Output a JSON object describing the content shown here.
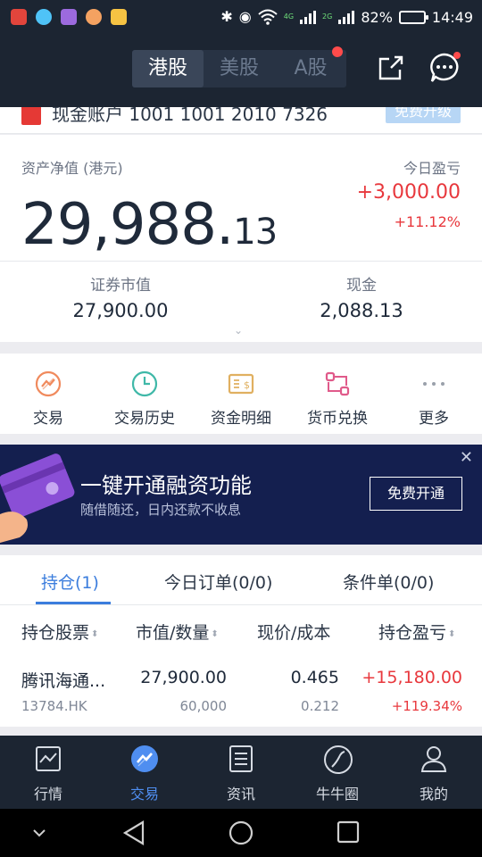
{
  "status_bar": {
    "network_labels": [
      "4G",
      "2G"
    ],
    "battery_percent": "82%",
    "battery_level": 0.82,
    "time": "14:49",
    "app_icons": [
      "weibo-icon",
      "heart-app-icon",
      "photo-app-icon",
      "game-app-icon",
      "wallet-app-icon"
    ],
    "system_icons": [
      "bluetooth-icon",
      "eye-icon",
      "wifi-icon"
    ]
  },
  "header": {
    "market_tabs": [
      {
        "label": "港股",
        "active": true
      },
      {
        "label": "美股",
        "active": false
      },
      {
        "label": "A股",
        "active": false,
        "badge": true
      }
    ],
    "icons": [
      "share-icon",
      "message-icon"
    ]
  },
  "account": {
    "text": "现金账户  1001 1001 2010 7326",
    "upgrade_button": "免费升级"
  },
  "assets": {
    "net_value_label": "资产净值 (港元)",
    "net_value_int": "29,988.",
    "net_value_dec": "13",
    "today_pl_label": "今日盈亏",
    "today_pl_value": "+3,000.00",
    "today_pl_pct": "+11.12%",
    "market_value_label": "证券市值",
    "market_value": "27,900.00",
    "cash_label": "现金",
    "cash_value": "2,088.13"
  },
  "actions": [
    {
      "label": "交易",
      "icon": "trade-icon",
      "color": "#f08a5d"
    },
    {
      "label": "交易历史",
      "icon": "clock-icon",
      "color": "#3fb8a8"
    },
    {
      "label": "资金明细",
      "icon": "fund-detail-icon",
      "color": "#e0b060"
    },
    {
      "label": "货币兑换",
      "icon": "exchange-icon",
      "color": "#e05a8a"
    },
    {
      "label": "更多",
      "icon": "more-icon",
      "color": "#9aa0aa"
    }
  ],
  "banner": {
    "title": "一键开通融资功能",
    "subtitle": "随借随还，日内还款不收息",
    "button": "免费开通",
    "close_icon": "close-icon"
  },
  "positions": {
    "tabs": [
      {
        "label": "持仓(1)",
        "active": true
      },
      {
        "label": "今日订单(0/0)",
        "active": false
      },
      {
        "label": "条件单(0/0)",
        "active": false
      }
    ],
    "headers": [
      "持仓股票",
      "市值/数量",
      "现价/成本",
      "持仓盈亏"
    ],
    "rows": [
      {
        "name": "腾讯海通...",
        "code": "13784.HK",
        "market_value": "27,900.00",
        "quantity": "60,000",
        "price": "0.465",
        "cost": "0.212",
        "pl": "+15,180.00",
        "pl_pct": "+119.34%"
      }
    ]
  },
  "bottom_nav": [
    {
      "label": "行情",
      "icon": "chart-icon",
      "active": false
    },
    {
      "label": "交易",
      "icon": "trade-icon",
      "active": true
    },
    {
      "label": "资讯",
      "icon": "news-icon",
      "active": false
    },
    {
      "label": "牛牛圈",
      "icon": "community-icon",
      "active": false
    },
    {
      "label": "我的",
      "icon": "profile-icon",
      "active": false
    }
  ],
  "colors": {
    "header_bg": "#1c2532",
    "accent_blue": "#3b7ddd",
    "gain_red": "#e8383d",
    "banner_bg": "#141f4f"
  }
}
